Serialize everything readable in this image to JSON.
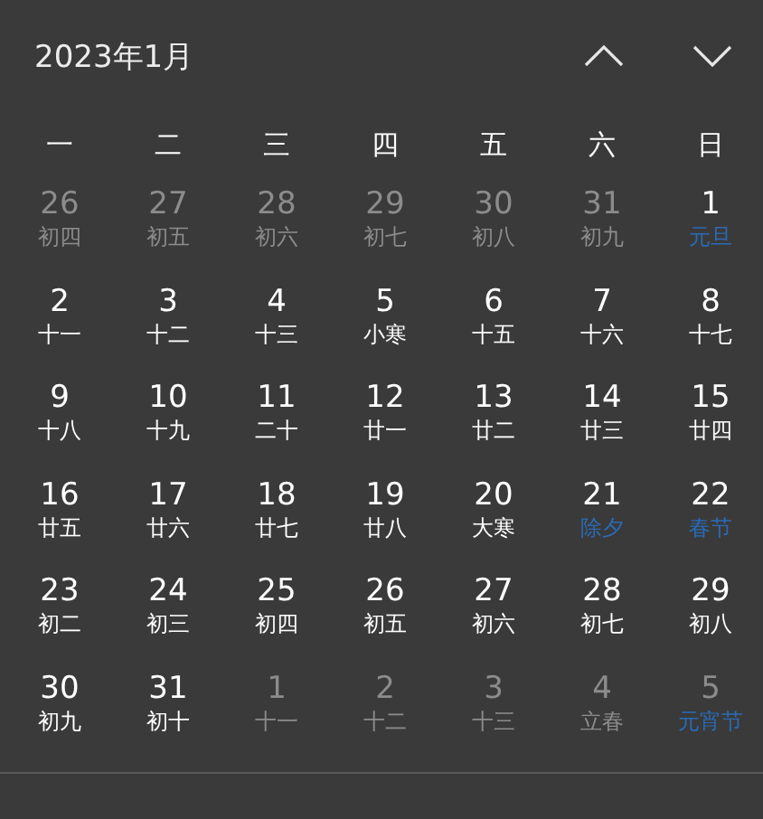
{
  "header": {
    "title": "2023年1月"
  },
  "weekdays": [
    "一",
    "二",
    "三",
    "四",
    "五",
    "六",
    "日"
  ],
  "days": [
    {
      "day": "26",
      "lunar": "初四",
      "in_month": false,
      "festival": false
    },
    {
      "day": "27",
      "lunar": "初五",
      "in_month": false,
      "festival": false
    },
    {
      "day": "28",
      "lunar": "初六",
      "in_month": false,
      "festival": false
    },
    {
      "day": "29",
      "lunar": "初七",
      "in_month": false,
      "festival": false
    },
    {
      "day": "30",
      "lunar": "初八",
      "in_month": false,
      "festival": false
    },
    {
      "day": "31",
      "lunar": "初九",
      "in_month": false,
      "festival": false
    },
    {
      "day": "1",
      "lunar": "元旦",
      "in_month": true,
      "festival": true
    },
    {
      "day": "2",
      "lunar": "十一",
      "in_month": true,
      "festival": false
    },
    {
      "day": "3",
      "lunar": "十二",
      "in_month": true,
      "festival": false
    },
    {
      "day": "4",
      "lunar": "十三",
      "in_month": true,
      "festival": false
    },
    {
      "day": "5",
      "lunar": "小寒",
      "in_month": true,
      "festival": false
    },
    {
      "day": "6",
      "lunar": "十五",
      "in_month": true,
      "festival": false
    },
    {
      "day": "7",
      "lunar": "十六",
      "in_month": true,
      "festival": false
    },
    {
      "day": "8",
      "lunar": "十七",
      "in_month": true,
      "festival": false
    },
    {
      "day": "9",
      "lunar": "十八",
      "in_month": true,
      "festival": false
    },
    {
      "day": "10",
      "lunar": "十九",
      "in_month": true,
      "festival": false
    },
    {
      "day": "11",
      "lunar": "二十",
      "in_month": true,
      "festival": false
    },
    {
      "day": "12",
      "lunar": "廿一",
      "in_month": true,
      "festival": false
    },
    {
      "day": "13",
      "lunar": "廿二",
      "in_month": true,
      "festival": false
    },
    {
      "day": "14",
      "lunar": "廿三",
      "in_month": true,
      "festival": false
    },
    {
      "day": "15",
      "lunar": "廿四",
      "in_month": true,
      "festival": false
    },
    {
      "day": "16",
      "lunar": "廿五",
      "in_month": true,
      "festival": false
    },
    {
      "day": "17",
      "lunar": "廿六",
      "in_month": true,
      "festival": false
    },
    {
      "day": "18",
      "lunar": "廿七",
      "in_month": true,
      "festival": false
    },
    {
      "day": "19",
      "lunar": "廿八",
      "in_month": true,
      "festival": false
    },
    {
      "day": "20",
      "lunar": "大寒",
      "in_month": true,
      "festival": false
    },
    {
      "day": "21",
      "lunar": "除夕",
      "in_month": true,
      "festival": true
    },
    {
      "day": "22",
      "lunar": "春节",
      "in_month": true,
      "festival": true
    },
    {
      "day": "23",
      "lunar": "初二",
      "in_month": true,
      "festival": false
    },
    {
      "day": "24",
      "lunar": "初三",
      "in_month": true,
      "festival": false
    },
    {
      "day": "25",
      "lunar": "初四",
      "in_month": true,
      "festival": false
    },
    {
      "day": "26",
      "lunar": "初五",
      "in_month": true,
      "festival": false
    },
    {
      "day": "27",
      "lunar": "初六",
      "in_month": true,
      "festival": false
    },
    {
      "day": "28",
      "lunar": "初七",
      "in_month": true,
      "festival": false
    },
    {
      "day": "29",
      "lunar": "初八",
      "in_month": true,
      "festival": false
    },
    {
      "day": "30",
      "lunar": "初九",
      "in_month": true,
      "festival": false
    },
    {
      "day": "31",
      "lunar": "初十",
      "in_month": true,
      "festival": false
    },
    {
      "day": "1",
      "lunar": "十一",
      "in_month": false,
      "festival": false
    },
    {
      "day": "2",
      "lunar": "十二",
      "in_month": false,
      "festival": false
    },
    {
      "day": "3",
      "lunar": "十三",
      "in_month": false,
      "festival": false
    },
    {
      "day": "4",
      "lunar": "立春",
      "in_month": false,
      "festival": false
    },
    {
      "day": "5",
      "lunar": "元宵节",
      "in_month": false,
      "festival": true
    }
  ]
}
